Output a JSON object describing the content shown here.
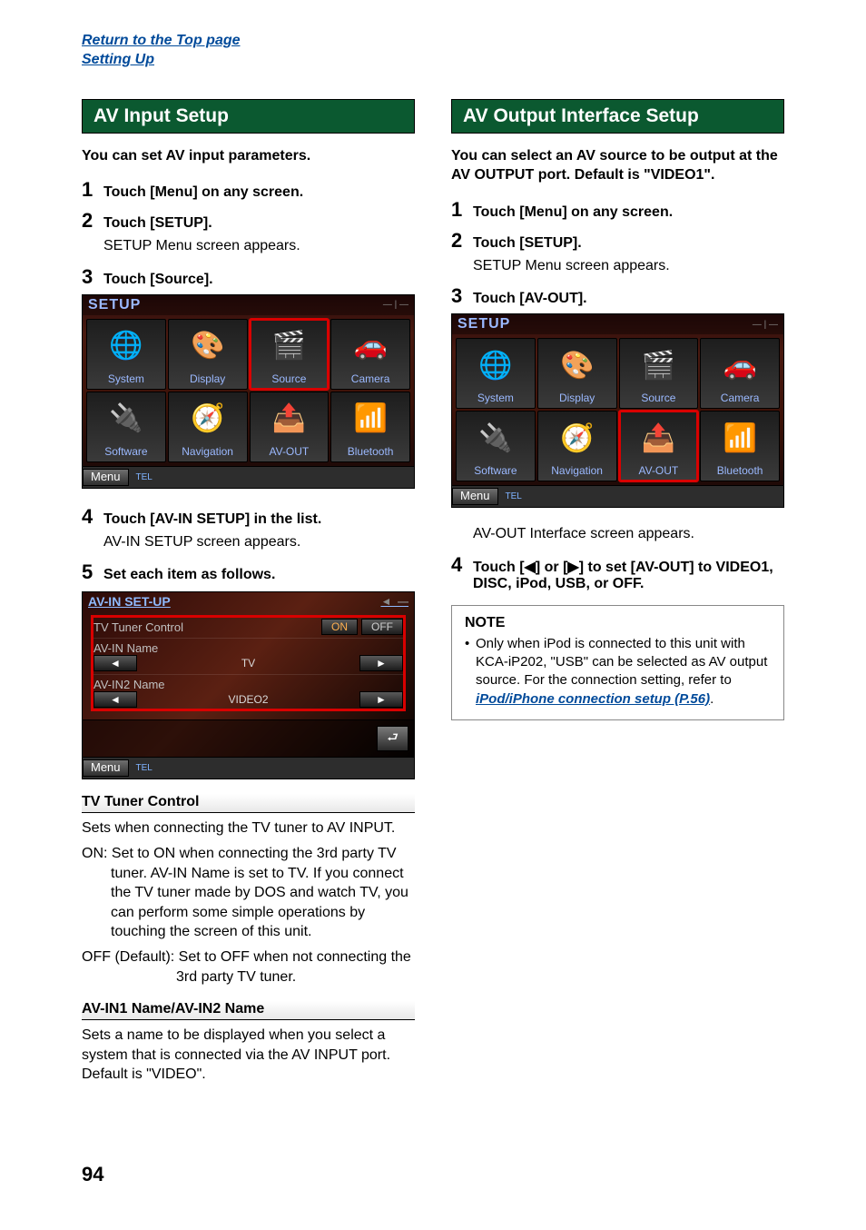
{
  "top_links": {
    "return": "Return to the Top page",
    "setting_up": "Setting Up"
  },
  "left": {
    "header": "AV Input Setup",
    "intro": "You can set AV input parameters.",
    "steps": [
      {
        "num": "1",
        "text": "Touch [Menu] on any screen."
      },
      {
        "num": "2",
        "text": "Touch [SETUP].",
        "sub": "SETUP Menu screen appears."
      },
      {
        "num": "3",
        "text": "Touch [Source]."
      }
    ],
    "setup_panel": {
      "title": "SETUP",
      "highlight": "Source",
      "items": [
        "System",
        "Display",
        "Source",
        "Camera",
        "Software",
        "Navigation",
        "AV-OUT",
        "Bluetooth"
      ],
      "menu": "Menu",
      "tel": "TEL"
    },
    "steps2": [
      {
        "num": "4",
        "text": "Touch [AV-IN SETUP] in the list.",
        "sub": "AV-IN SETUP screen appears."
      },
      {
        "num": "5",
        "text": "Set each item as follows."
      }
    ],
    "avin_panel": {
      "title": "AV-IN SET-UP",
      "row1_label": "TV Tuner Control",
      "on": "ON",
      "off": "OFF",
      "row2_label": "AV-IN Name",
      "row2_value": "TV",
      "row3_label": "AV-IN2 Name",
      "row3_value": "VIDEO2",
      "menu": "Menu",
      "tel": "TEL",
      "back": "⮐"
    },
    "param_tv": {
      "head": "TV Tuner Control",
      "desc": "Sets when connecting the TV tuner to AV INPUT.",
      "on_text": "ON: Set to ON when connecting the 3rd party TV tuner. AV-IN Name is set to TV. If you connect the TV tuner made by DOS and watch TV, you can perform some simple operations by touching the screen of this unit.",
      "off_text": "OFF (Default): Set to OFF when not connecting the 3rd party TV tuner."
    },
    "param_name": {
      "head": "AV-IN1 Name/AV-IN2 Name",
      "desc": "Sets a name to be displayed when you select a system that is connected via the AV INPUT port. Default is \"VIDEO\"."
    }
  },
  "right": {
    "header": "AV Output Interface Setup",
    "intro": "You can select an AV source to be output at the AV OUTPUT port. Default is \"VIDEO1\".",
    "steps": [
      {
        "num": "1",
        "text": "Touch [Menu] on any screen."
      },
      {
        "num": "2",
        "text": "Touch [SETUP].",
        "sub": "SETUP Menu screen appears."
      },
      {
        "num": "3",
        "text": "Touch [AV-OUT]."
      }
    ],
    "setup_panel": {
      "title": "SETUP",
      "highlight": "AV-OUT",
      "items": [
        "System",
        "Display",
        "Source",
        "Camera",
        "Software",
        "Navigation",
        "AV-OUT",
        "Bluetooth"
      ],
      "menu": "Menu",
      "tel": "TEL"
    },
    "sub_after_panel": "AV-OUT Interface screen appears.",
    "step4": {
      "num": "4",
      "text": "Touch [◀] or [▶] to set [AV-OUT] to VIDEO1, DISC, iPod, USB, or OFF."
    },
    "note": {
      "title": "NOTE",
      "body_pre": "Only when iPod is connected to this unit with KCA-iP202, \"USB\" can be selected as AV output source. For the connection setting, refer to ",
      "link": "iPod/iPhone connection setup (P.56)",
      "body_post": "."
    }
  },
  "icons": {
    "system": "🌐",
    "display": "🎨",
    "source": "🎬",
    "camera": "🚗",
    "software": "🔌",
    "navigation": "🧭",
    "avout": "📤",
    "bluetooth": "📶"
  },
  "page_number": "94"
}
